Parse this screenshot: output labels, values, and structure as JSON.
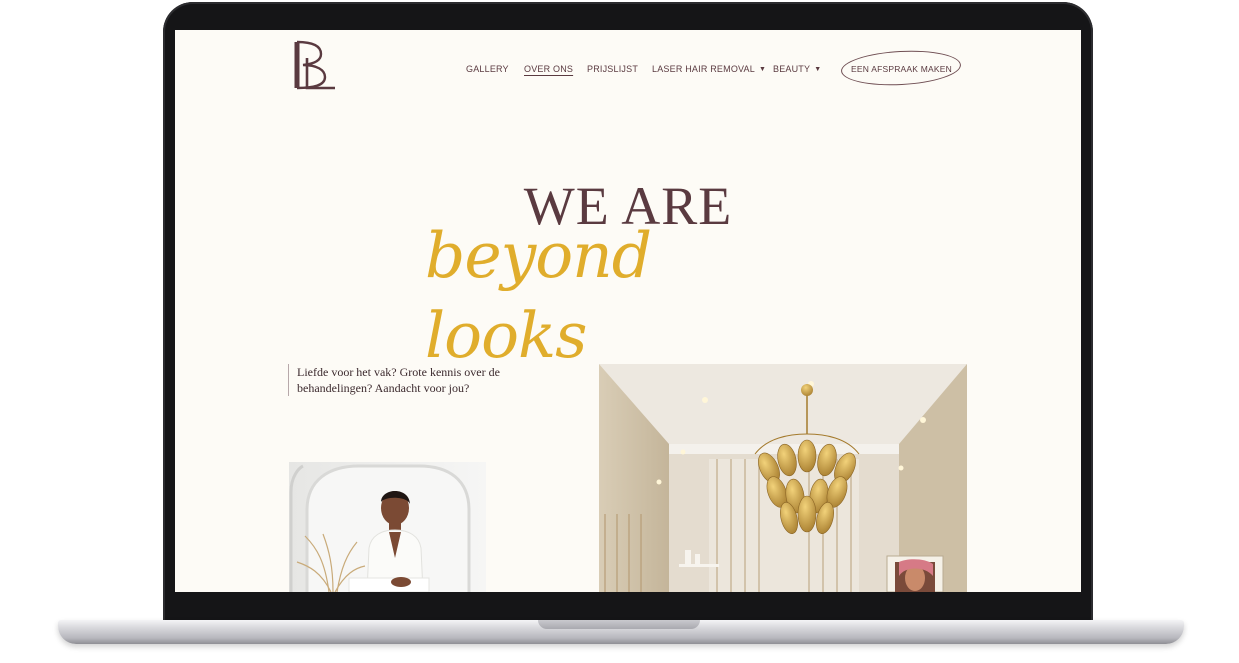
{
  "site": {
    "logo_letters": "BL"
  },
  "nav": {
    "items": [
      {
        "label": "GALLERY",
        "active": false,
        "dropdown": false
      },
      {
        "label": "OVER ONS",
        "active": true,
        "dropdown": false
      },
      {
        "label": "PRIJSLIJST",
        "active": false,
        "dropdown": false
      },
      {
        "label": "LASER HAIR REMOVAL",
        "active": false,
        "dropdown": true
      },
      {
        "label": "BEAUTY",
        "active": false,
        "dropdown": true
      }
    ],
    "cta_label": "EEN AFSPRAAK MAKEN"
  },
  "hero": {
    "title": "WE ARE",
    "script": "beyond looks"
  },
  "intro": {
    "quote": "Liefde voor het vak? Grote kennis over de behandelingen? Aandacht voor jou?"
  },
  "colors": {
    "brand": "#5a3a40",
    "accent": "#e0ad2c",
    "background": "#fdfbf6"
  },
  "icons": {
    "dropdown": "caret-down-icon"
  }
}
